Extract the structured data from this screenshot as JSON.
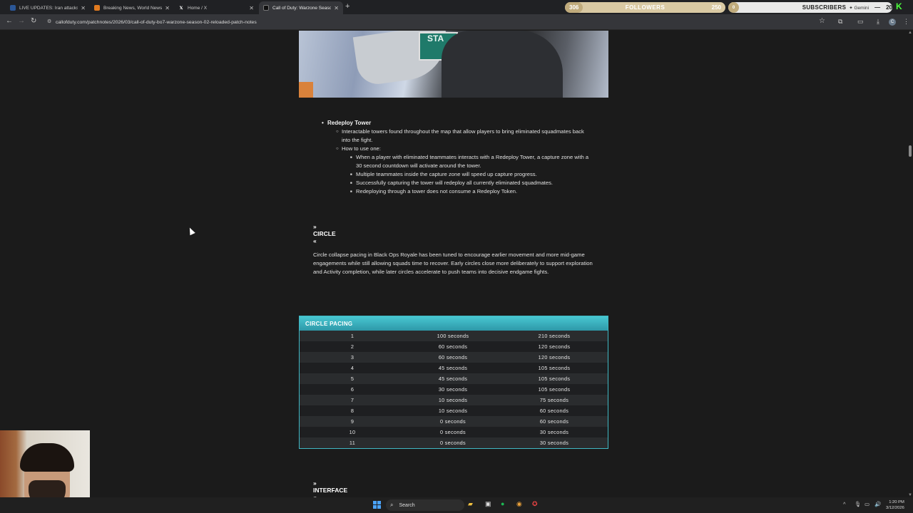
{
  "browser": {
    "tabs": [
      {
        "title": "LIVE UPDATES: Iran attacks spr",
        "favicon_color": "#2b5797",
        "active": false
      },
      {
        "title": "Breaking News, World News an",
        "favicon_color": "#e07a1f",
        "active": false
      },
      {
        "title": "Home / X",
        "favicon_color": "#000000",
        "favicon_glyph": "X",
        "active": false
      },
      {
        "title": "Call of Duty: Warzone Season 0",
        "favicon_color": "#111111",
        "active": true
      }
    ],
    "url": "callofduty.com/patchnotes/2026/03/call-of-duty-bo7-warzone-season-02-reloaded-patch-notes"
  },
  "overlay": {
    "followers_current": "306",
    "followers_label": "FOLLOWERS",
    "followers_goal": "250",
    "subs_current": "0",
    "subs_label": "SUBSCRIBERS",
    "gemini_label": "✦ Gemini",
    "subs_goal": "20",
    "brand_color": "#4cff3d"
  },
  "article": {
    "hero_sign_text": "STA",
    "redeploy": {
      "title": "Redeploy Tower",
      "desc": "Interactable towers found throughout the map that allow players to bring eliminated squadmates back into the fight.",
      "how_label": "How to use one:",
      "steps": [
        "When a player with eliminated teammates interacts with a Redeploy Tower, a capture zone with a 30 second countdown will activate around the tower.",
        "Multiple teammates inside the capture zone will speed up capture progress.",
        "Successfully capturing the tower will redeploy all currently eliminated squadmates.",
        "Redeploying through a tower does not consume a Redeploy Token."
      ]
    },
    "circle_heading": "» CIRCLE «",
    "circle_paragraph": "Circle collapse pacing in Black Ops Royale has been tuned to encourage earlier movement and more mid-game engagements while still allowing squads time to recover. Early circles close more deliberately to support exploration and Activity completion, while later circles accelerate to push teams into decisive endgame fights.",
    "table": {
      "title": "CIRCLE PACING",
      "accent": "#40b8c4",
      "rows": [
        [
          "1",
          "100 seconds",
          "210 seconds"
        ],
        [
          "2",
          "60 seconds",
          "120 seconds"
        ],
        [
          "3",
          "60 seconds",
          "120 seconds"
        ],
        [
          "4",
          "45 seconds",
          "105 seconds"
        ],
        [
          "5",
          "45 seconds",
          "105 seconds"
        ],
        [
          "6",
          "30 seconds",
          "105 seconds"
        ],
        [
          "7",
          "10 seconds",
          "75 seconds"
        ],
        [
          "8",
          "10 seconds",
          "60 seconds"
        ],
        [
          "9",
          "0 seconds",
          "60 seconds"
        ],
        [
          "10",
          "0 seconds",
          "30 seconds"
        ],
        [
          "11",
          "0 seconds",
          "30 seconds"
        ]
      ]
    },
    "interface_heading": "» INTERFACE «"
  },
  "taskbar": {
    "search_placeholder": "Search",
    "time": "1:20 PM",
    "date": "3/12/2026"
  }
}
